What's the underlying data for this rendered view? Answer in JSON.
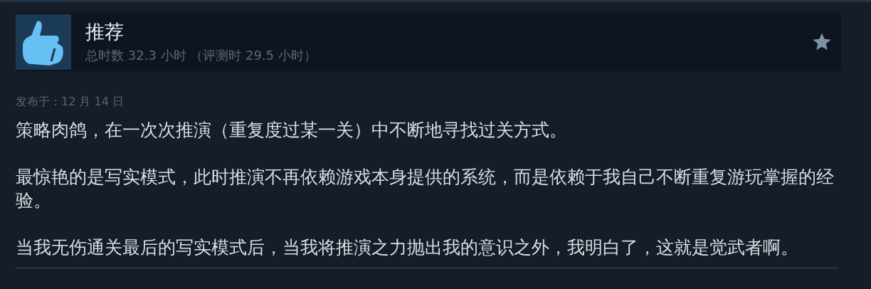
{
  "review": {
    "verdict": "推荐",
    "recommended": true,
    "hours": "总时数 32.3 小时 （评测时 29.5 小时）",
    "starred": false
  },
  "posted": "发布于：12 月 14 日",
  "paragraphs": [
    "策略肉鸽，在一次次推演（重复度过某一关）中不断地寻找过关方式。",
    "最惊艳的是写实模式，此时推演不再依赖游戏本身提供的系统，而是依赖于我自己不断重复游玩掌握的经验。",
    "当我无伤通关最后的写实模式后，当我将推演之力抛出我的意识之外，我明白了，这就是觉武者啊。"
  ]
}
